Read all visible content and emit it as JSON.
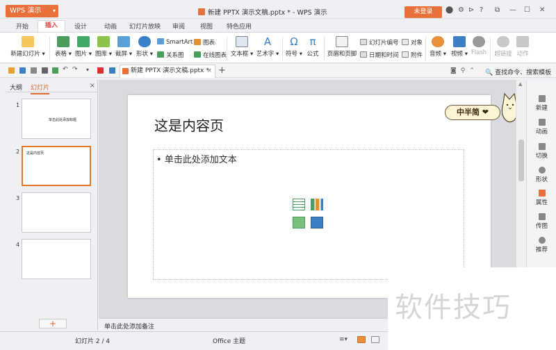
{
  "window": {
    "app_button": "WPS 演示",
    "title": "新建 PPTX 演示文稿.pptx * - WPS 演示",
    "login_button": "未登录"
  },
  "menu_tabs": [
    "开始",
    "插入",
    "设计",
    "动画",
    "幻灯片放映",
    "审阅",
    "视图",
    "特色应用"
  ],
  "ribbon": {
    "new_slide": "新建幻灯片",
    "table": "表格",
    "picture": "图片",
    "gallery": "图库",
    "screenshot": "截屏",
    "shape": "形状",
    "smartart": "SmartArt",
    "relation": "关系图",
    "chart": "图表",
    "online_chart": "在线图表",
    "textbox": "文本框",
    "wordart": "艺术字",
    "symbol": "符号",
    "formula": "公式",
    "header_footer": "页眉和页脚",
    "slide_number": "幻灯片编号",
    "object": "对象",
    "date_time": "日期和时间",
    "attachment": "附件",
    "audio": "音频",
    "video": "视频",
    "flash": "Flash",
    "hyperlink": "超链接",
    "action": "动作"
  },
  "toolbar2": {
    "doc_tab": "新建 PPTX 演示文稿.pptx *",
    "search": "查找命令、搜索模板"
  },
  "left_panel": {
    "tab_outline": "大纲",
    "tab_slides": "幻灯片",
    "thumbs": [
      {
        "num": "1",
        "text": "单击此处添加标题"
      },
      {
        "num": "2",
        "text": "这是内容页"
      },
      {
        "num": "3",
        "text": ""
      },
      {
        "num": "4",
        "text": ""
      }
    ]
  },
  "slide": {
    "title": "这是内容页",
    "content_placeholder": "• 单击此处添加文本",
    "badge_text": "中半简 ❤"
  },
  "notes": {
    "placeholder": "单击此处添加备注"
  },
  "right_sidebar": [
    "新建",
    "动画",
    "切换",
    "形状",
    "属性",
    "传图",
    "推荐"
  ],
  "status": {
    "slide_counter": "幻灯片 2 / 4",
    "theme": "Office 主题"
  },
  "watermark": "软件技巧",
  "colors": {
    "accent": "#e8703a",
    "selected_thumb": "#e07828",
    "insert_tab": "#dd4444"
  }
}
